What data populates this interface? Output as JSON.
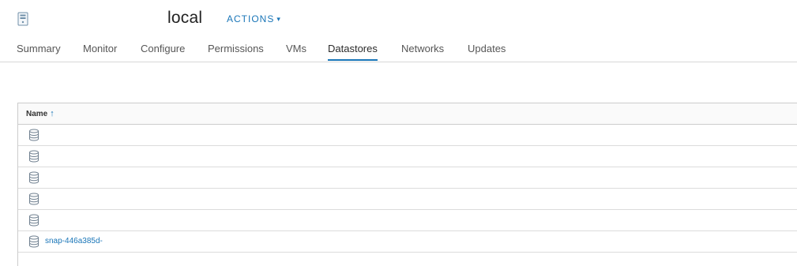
{
  "header": {
    "host_name": "local",
    "actions_label": "ACTIONS",
    "actions_chevron": "▾"
  },
  "tabs": [
    {
      "label": "Summary"
    },
    {
      "label": "Monitor"
    },
    {
      "label": "Configure"
    },
    {
      "label": "Permissions"
    },
    {
      "label": "VMs"
    },
    {
      "label": "Datastores",
      "active": true
    },
    {
      "label": "Networks"
    },
    {
      "label": "Updates"
    }
  ],
  "grid": {
    "column_name": "Name",
    "sort_indicator": "↑",
    "rows": [
      {
        "name": ""
      },
      {
        "name": ""
      },
      {
        "name": ""
      },
      {
        "name": ""
      },
      {
        "name": ""
      },
      {
        "name": "snap-446a385d-"
      }
    ]
  },
  "colors": {
    "accent": "#1a76b8",
    "border": "#cccccc"
  }
}
